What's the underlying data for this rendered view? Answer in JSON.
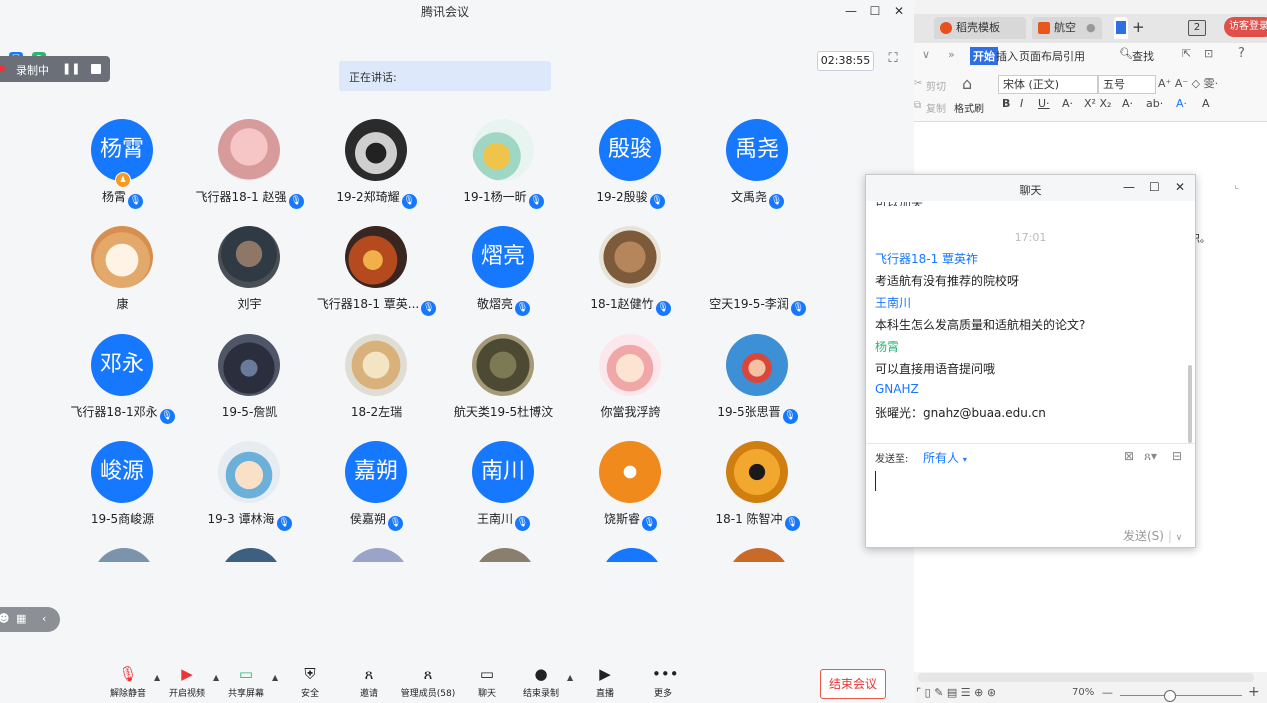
{
  "meeting": {
    "title": "腾讯会议",
    "timer": "02:38:55",
    "recording_label": "录制中",
    "speaking_label": "正在讲话:",
    "participants": [
      {
        "name": "杨霄",
        "avatar_text": "杨霄",
        "avatar": "text",
        "mic": true,
        "host": true
      },
      {
        "name": "飞行器18-1 赵强",
        "avatar": "cartoon-beaver",
        "mic": true
      },
      {
        "name": "19-2郑琦耀",
        "avatar": "dog-sunglasses",
        "mic": true
      },
      {
        "name": "19-1杨一昕",
        "avatar": "cartoon-cats",
        "mic": true
      },
      {
        "name": "19-2殷骏",
        "avatar_text": "殷骏",
        "avatar": "text",
        "mic": true
      },
      {
        "name": "文禹尧",
        "avatar_text": "禹尧",
        "avatar": "text",
        "mic": true
      },
      {
        "name": "康",
        "avatar": "cat-face",
        "mic": false
      },
      {
        "name": "刘宇",
        "avatar": "man-photo",
        "mic": false
      },
      {
        "name": "飞行器18-1 覃英...",
        "avatar": "fire-photo",
        "mic": true
      },
      {
        "name": "敬熠亮",
        "avatar_text": "熠亮",
        "avatar": "text",
        "mic": true
      },
      {
        "name": "18-1赵健竹",
        "avatar": "puppy-photo",
        "mic": true
      },
      {
        "name": "空天19-5-李润",
        "avatar": "none",
        "mic": true
      },
      {
        "name": "飞行器18-1邓永",
        "avatar_text": "邓永",
        "avatar": "text",
        "mic": true
      },
      {
        "name": "19-5-詹凯",
        "avatar": "dark-creature",
        "mic": false
      },
      {
        "name": "18-2左瑞",
        "avatar": "golden-dog",
        "mic": false
      },
      {
        "name": "航天类19-5杜博汶",
        "avatar": "soldier-photo",
        "mic": false
      },
      {
        "name": "你當我浮誇",
        "avatar": "cartoon-girl",
        "mic": false
      },
      {
        "name": "19-5张思晋",
        "avatar": "ponyo",
        "mic": true
      },
      {
        "name": "19-5商峻源",
        "avatar_text": "峻源",
        "avatar": "text",
        "mic": false
      },
      {
        "name": "19-3 谭林海",
        "avatar": "cartoon-face",
        "mic": true
      },
      {
        "name": "侯嘉朔",
        "avatar_text": "嘉朔",
        "avatar": "text",
        "mic": true
      },
      {
        "name": "王南川",
        "avatar_text": "南川",
        "avatar": "text",
        "mic": true
      },
      {
        "name": "饶斯睿",
        "avatar": "orange-figure",
        "mic": true
      },
      {
        "name": "18-1 陈智冲",
        "avatar": "sun-emblem",
        "mic": true
      }
    ],
    "toolbar": [
      {
        "label": "解除静音",
        "icon": "mic-muted-icon",
        "caret": true
      },
      {
        "label": "开启视频",
        "icon": "video-off-icon",
        "caret": true
      },
      {
        "label": "共享屏幕",
        "icon": "share-screen-icon",
        "caret": true
      },
      {
        "label": "安全",
        "icon": "shield-icon",
        "caret": false
      },
      {
        "label": "邀请",
        "icon": "add-user-icon",
        "caret": false
      },
      {
        "label": "管理成员(58)",
        "icon": "members-icon",
        "caret": false
      },
      {
        "label": "聊天",
        "icon": "chat-icon",
        "caret": false
      },
      {
        "label": "结束录制",
        "icon": "stop-record-icon",
        "caret": true
      },
      {
        "label": "直播",
        "icon": "live-icon",
        "caret": false
      },
      {
        "label": "更多",
        "icon": "more-icon",
        "caret": false
      }
    ],
    "end_meeting": "结束会议"
  },
  "chat": {
    "title": "聊天",
    "time": "17:01",
    "messages": [
      {
        "sender": "飞行器18-1 覃英祚",
        "text": "考适航有没有推荐的院校呀",
        "color": "blue"
      },
      {
        "sender": "王南川",
        "text": "本科生怎么发高质量和适航相关的论文?",
        "color": "blue"
      },
      {
        "sender": "杨霄",
        "text": "可以直接用语音提问哦",
        "color": "green"
      },
      {
        "sender": "GNAHZ",
        "text": "张曜光：gnahz@buaa.edu.cn",
        "color": "blue"
      }
    ],
    "send_to_label": "发送至:",
    "send_to_value": "所有人",
    "send_button": "发送(S)"
  },
  "wps": {
    "tabs": [
      {
        "label": "稻壳模板"
      },
      {
        "label": "航空"
      }
    ],
    "tab_count": "2",
    "guest_login": "访客登录",
    "ribbon_tabs": [
      "开始",
      "插入",
      "页面布局",
      "引用"
    ],
    "search": "查找",
    "font_name": "宋体 (正文)",
    "font_size": "五号",
    "cut": "剪切",
    "copy": "复制",
    "format_painter": "格式刷",
    "doc_fragment": "识。",
    "zoom": "70%"
  },
  "colors": {
    "accent": "#1677ff",
    "end_red": "#e33333",
    "host_green": "#2bb673"
  }
}
